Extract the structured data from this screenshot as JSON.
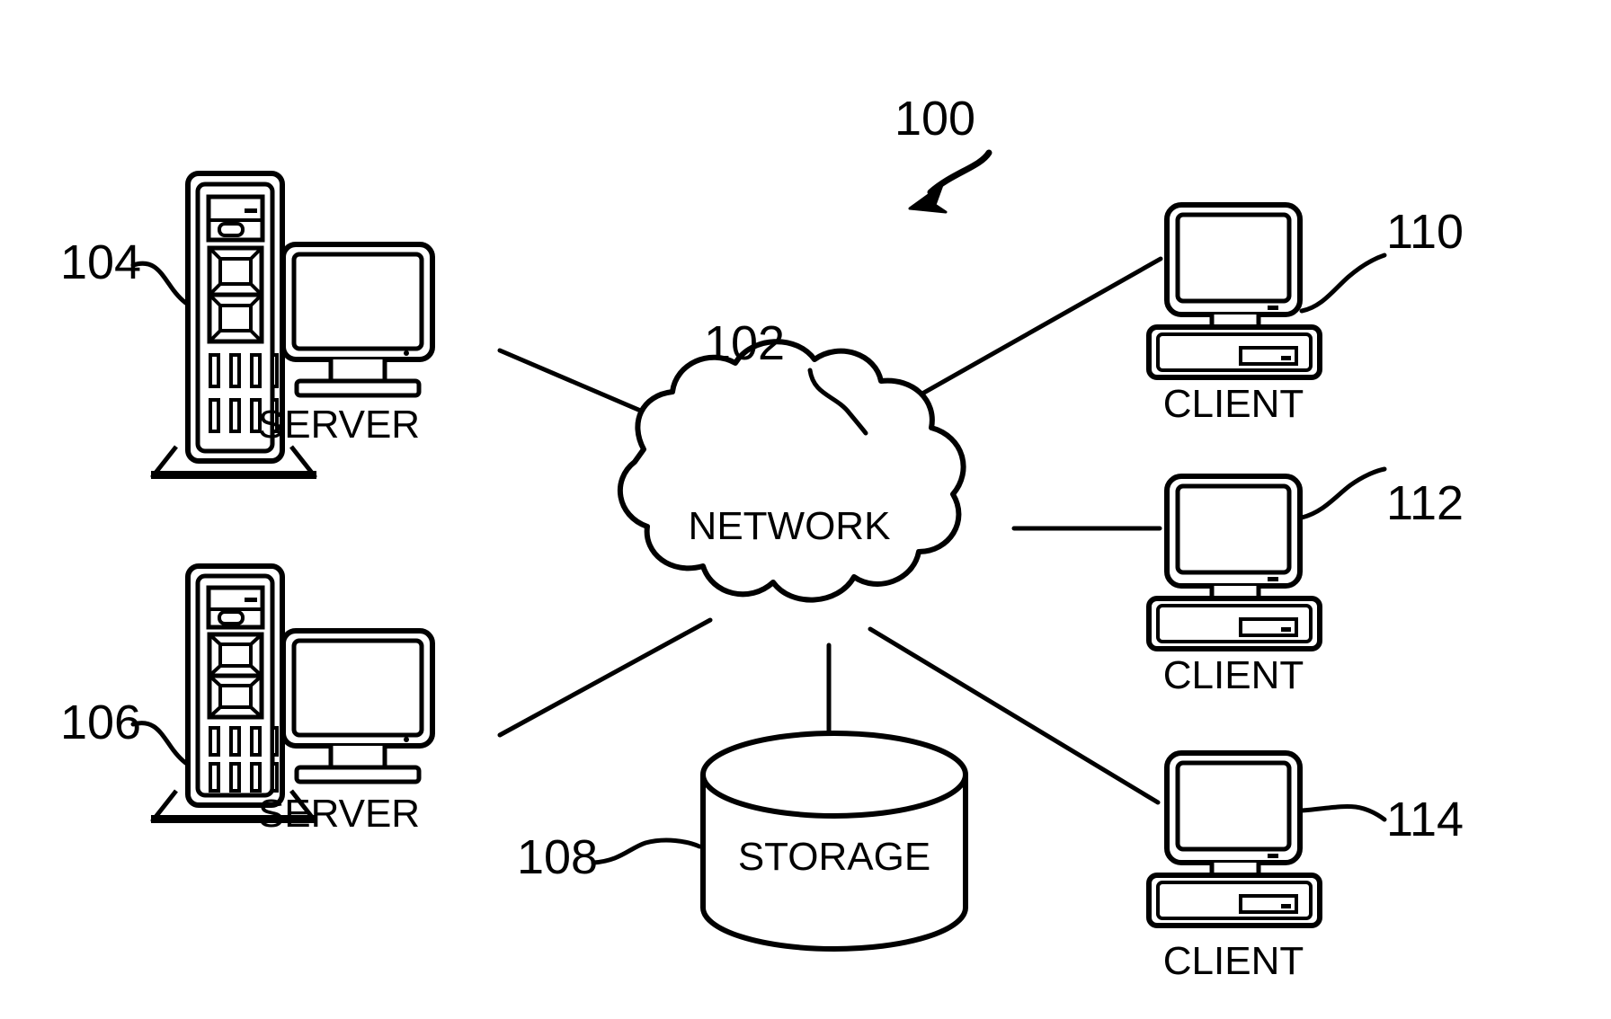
{
  "figure": {
    "title_number": "100",
    "background_color": "#ffffff",
    "line_color": "#000000",
    "type": "patent-network-architecture-diagram"
  },
  "reference_numerals": {
    "system": "100",
    "network": "102",
    "server_top": "104",
    "server_bottom": "106",
    "storage": "108",
    "client_top": "110",
    "client_middle": "112",
    "client_bottom": "114"
  },
  "nodes": {
    "network": {
      "numeral": "102",
      "label": "NETWORK",
      "shape": "cloud"
    },
    "storage": {
      "numeral": "108",
      "label": "STORAGE",
      "shape": "cylinder"
    },
    "servers": [
      {
        "numeral": "104",
        "label": "SERVER",
        "shape": "tower-and-monitor"
      },
      {
        "numeral": "106",
        "label": "SERVER",
        "shape": "tower-and-monitor"
      }
    ],
    "clients": [
      {
        "numeral": "110",
        "label": "CLIENT",
        "shape": "monitor-and-desktop"
      },
      {
        "numeral": "112",
        "label": "CLIENT",
        "shape": "monitor-and-desktop"
      },
      {
        "numeral": "114",
        "label": "CLIENT",
        "shape": "monitor-and-desktop"
      }
    ]
  },
  "connections": [
    {
      "from": "104",
      "to": "102"
    },
    {
      "from": "106",
      "to": "102"
    },
    {
      "from": "102",
      "to": "110"
    },
    {
      "from": "102",
      "to": "112"
    },
    {
      "from": "102",
      "to": "114"
    },
    {
      "from": "102",
      "to": "108"
    }
  ]
}
